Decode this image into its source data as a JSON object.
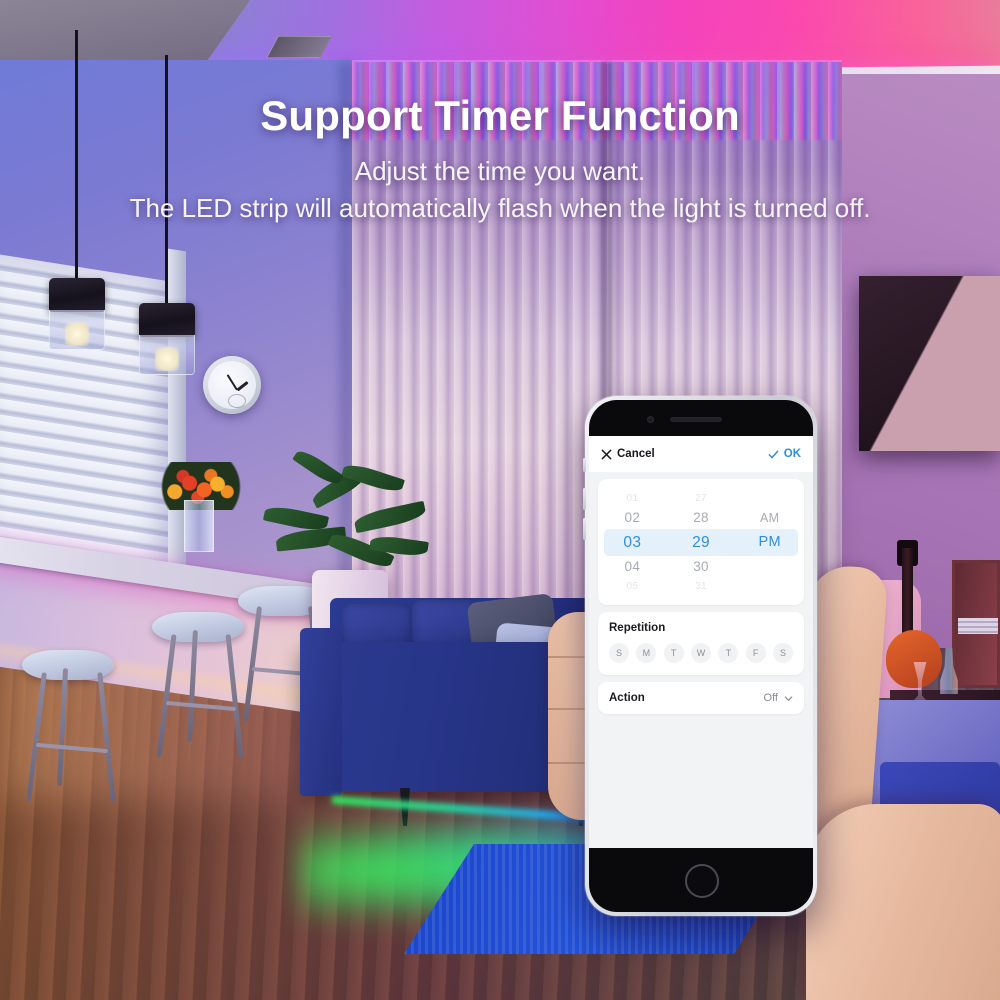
{
  "banner": {
    "headline": "Support Timer Function",
    "subtitle_line1": "Adjust the time you want.",
    "subtitle_line2": "The LED strip will automatically flash when the light is turned off."
  },
  "phone_app": {
    "header": {
      "cancel_label": "Cancel",
      "cancel_icon": "close-icon",
      "ok_label": "OK",
      "ok_icon": "check-icon",
      "ok_color": "#2f8fd8"
    },
    "time_picker": {
      "selected_hour": "03",
      "selected_minute": "29",
      "selected_period": "PM",
      "highlight_color": "#e4f1fa",
      "selected_text_color": "#2f8fd8",
      "hours": [
        "01",
        "02",
        "03",
        "04",
        "05"
      ],
      "minutes": [
        "27",
        "28",
        "29",
        "30",
        "31"
      ],
      "periods": [
        "AM",
        "PM"
      ]
    },
    "repetition": {
      "title": "Repetition",
      "days": [
        {
          "label": "S"
        },
        {
          "label": "M"
        },
        {
          "label": "T"
        },
        {
          "label": "W"
        },
        {
          "label": "T"
        },
        {
          "label": "F"
        },
        {
          "label": "S"
        }
      ]
    },
    "action": {
      "label": "Action",
      "value": "Off",
      "chevron_icon": "chevron-down-icon"
    }
  },
  "scene": {
    "accent_magenta": "#f43fbb",
    "accent_purple": "#8e7fd6",
    "accent_blue": "#2b3b8e",
    "accent_green": "#35e45c"
  }
}
